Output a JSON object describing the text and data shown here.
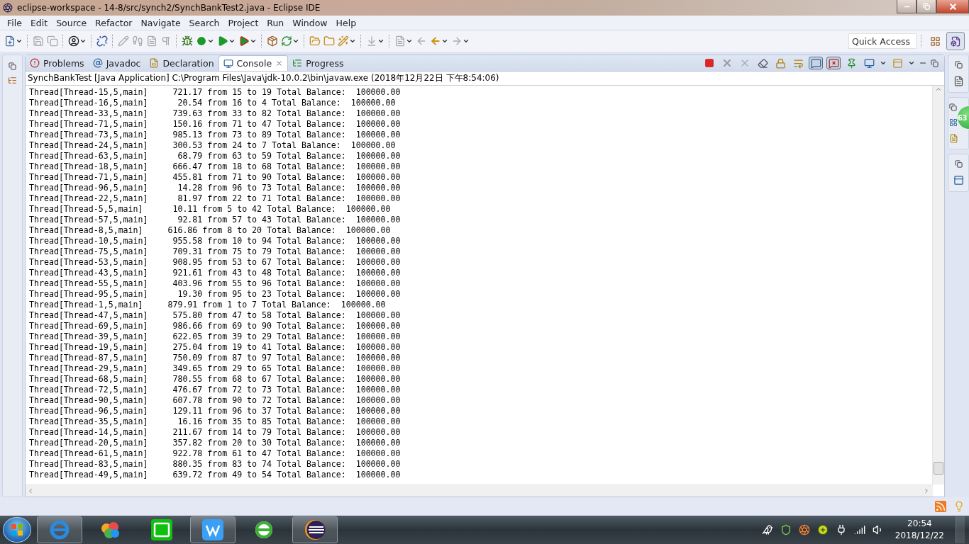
{
  "window": {
    "title": "eclipse-workspace - 14-8/src/synch2/SynchBankTest2.java - Eclipse IDE"
  },
  "menu": [
    "File",
    "Edit",
    "Source",
    "Refactor",
    "Navigate",
    "Search",
    "Project",
    "Run",
    "Window",
    "Help"
  ],
  "quick_access": {
    "placeholder": "Quick Access"
  },
  "view_tabs": [
    {
      "label": "Problems",
      "selected": false
    },
    {
      "label": "Javadoc",
      "selected": false
    },
    {
      "label": "Declaration",
      "selected": false
    },
    {
      "label": "Console",
      "selected": true
    },
    {
      "label": "Progress",
      "selected": false
    }
  ],
  "console_toolbar": [
    {
      "kind": "terminate",
      "pressed": false
    },
    {
      "kind": "remove",
      "pressed": false
    },
    {
      "kind": "remove-all",
      "pressed": false
    },
    {
      "kind": "clear",
      "pressed": false
    },
    {
      "kind": "scroll-lock",
      "pressed": false
    },
    {
      "kind": "word-wrap",
      "pressed": false
    },
    {
      "kind": "show-out",
      "pressed": true
    },
    {
      "kind": "show-err",
      "pressed": true
    },
    {
      "kind": "pin",
      "pressed": false
    },
    {
      "kind": "display",
      "pressed": false
    },
    {
      "kind": "new-console",
      "pressed": false
    }
  ],
  "console": {
    "header": "SynchBankTest [Java Application] C:\\Program Files\\Java\\jdk-10.0.2\\bin\\javaw.exe (2018年12月22日 下午8:54:06)",
    "lines": [
      "Thread[Thread-15,5,main]     721.17 from 15 to 19 Total Balance:  100000.00",
      "Thread[Thread-16,5,main]      20.54 from 16 to 4 Total Balance:  100000.00",
      "Thread[Thread-33,5,main]     739.63 from 33 to 82 Total Balance:  100000.00",
      "Thread[Thread-71,5,main]     150.16 from 71 to 47 Total Balance:  100000.00",
      "Thread[Thread-73,5,main]     985.13 from 73 to 89 Total Balance:  100000.00",
      "Thread[Thread-24,5,main]     300.53 from 24 to 7 Total Balance:  100000.00",
      "Thread[Thread-63,5,main]      68.79 from 63 to 59 Total Balance:  100000.00",
      "Thread[Thread-18,5,main]     666.47 from 18 to 68 Total Balance:  100000.00",
      "Thread[Thread-71,5,main]     455.81 from 71 to 90 Total Balance:  100000.00",
      "Thread[Thread-96,5,main]      14.28 from 96 to 73 Total Balance:  100000.00",
      "Thread[Thread-22,5,main]      81.97 from 22 to 71 Total Balance:  100000.00",
      "Thread[Thread-5,5,main]      10.11 from 5 to 42 Total Balance:  100000.00",
      "Thread[Thread-57,5,main]      92.81 from 57 to 43 Total Balance:  100000.00",
      "Thread[Thread-8,5,main]     616.86 from 8 to 20 Total Balance:  100000.00",
      "Thread[Thread-10,5,main]     955.58 from 10 to 94 Total Balance:  100000.00",
      "Thread[Thread-75,5,main]     709.31 from 75 to 79 Total Balance:  100000.00",
      "Thread[Thread-53,5,main]     908.95 from 53 to 67 Total Balance:  100000.00",
      "Thread[Thread-43,5,main]     921.61 from 43 to 48 Total Balance:  100000.00",
      "Thread[Thread-55,5,main]     403.96 from 55 to 96 Total Balance:  100000.00",
      "Thread[Thread-95,5,main]      19.30 from 95 to 23 Total Balance:  100000.00",
      "Thread[Thread-1,5,main]     879.91 from 1 to 7 Total Balance:  100000.00",
      "Thread[Thread-47,5,main]     575.80 from 47 to 58 Total Balance:  100000.00",
      "Thread[Thread-69,5,main]     986.66 from 69 to 90 Total Balance:  100000.00",
      "Thread[Thread-39,5,main]     622.05 from 39 to 29 Total Balance:  100000.00",
      "Thread[Thread-19,5,main]     275.04 from 19 to 41 Total Balance:  100000.00",
      "Thread[Thread-87,5,main]     750.09 from 87 to 97 Total Balance:  100000.00",
      "Thread[Thread-29,5,main]     349.65 from 29 to 65 Total Balance:  100000.00",
      "Thread[Thread-68,5,main]     780.55 from 68 to 67 Total Balance:  100000.00",
      "Thread[Thread-72,5,main]     476.67 from 72 to 73 Total Balance:  100000.00",
      "Thread[Thread-90,5,main]     607.78 from 90 to 72 Total Balance:  100000.00",
      "Thread[Thread-96,5,main]     129.11 from 96 to 37 Total Balance:  100000.00",
      "Thread[Thread-35,5,main]      16.16 from 35 to 85 Total Balance:  100000.00",
      "Thread[Thread-14,5,main]     211.67 from 14 to 79 Total Balance:  100000.00",
      "Thread[Thread-20,5,main]     357.82 from 20 to 30 Total Balance:  100000.00",
      "Thread[Thread-61,5,main]     922.78 from 61 to 47 Total Balance:  100000.00",
      "Thread[Thread-83,5,main]     880.35 from 83 to 74 Total Balance:  100000.00",
      "Thread[Thread-49,5,main]     639.72 from 49 to 54 Total Balance:  100000.00"
    ]
  },
  "floating_badge": "63",
  "clock": {
    "time": "20:54",
    "date": "2018/12/22"
  }
}
